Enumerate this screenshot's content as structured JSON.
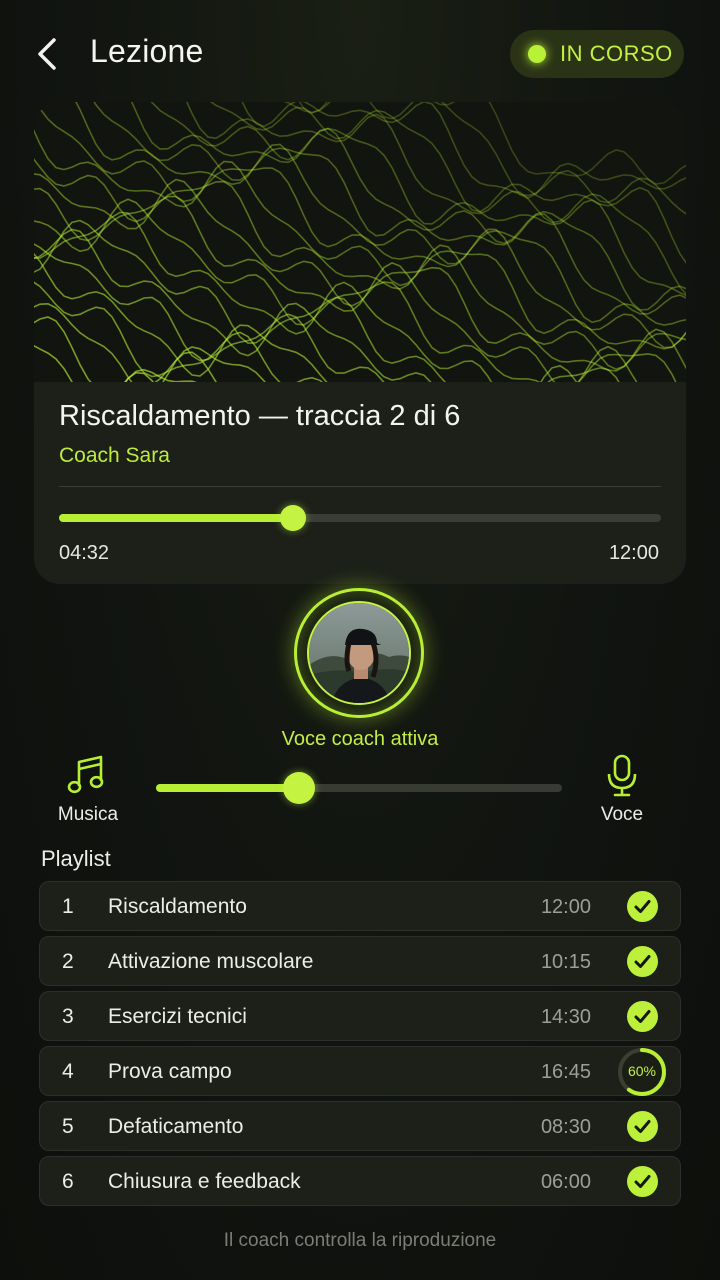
{
  "header": {
    "title": "Lezione",
    "status": "IN CORSO"
  },
  "player": {
    "track_title": "Riscaldamento — traccia 2 di 6",
    "coach_name": "Coach Sara",
    "elapsed": "04:32",
    "total": "12:00",
    "progress_fraction": 0.388
  },
  "coach": {
    "label": "Voce coach attiva"
  },
  "mix": {
    "left_label": "Musica",
    "right_label": "Voce",
    "level_fraction": 0.352
  },
  "playlist": {
    "heading": "Playlist",
    "items": [
      {
        "num": "1",
        "name": "Riscaldamento",
        "duration": "12:00",
        "state": "done"
      },
      {
        "num": "2",
        "name": "Attivazione muscolare",
        "duration": "10:15",
        "state": "done"
      },
      {
        "num": "3",
        "name": "Esercizi tecnici",
        "duration": "14:30",
        "state": "done"
      },
      {
        "num": "4",
        "name": "Prova campo",
        "duration": "16:45",
        "state": "progress",
        "progress_label": "60%",
        "progress_fraction": 0.6
      },
      {
        "num": "5",
        "name": "Defaticamento",
        "duration": "08:30",
        "state": "done"
      },
      {
        "num": "6",
        "name": "Chiusura e feedback",
        "duration": "06:00",
        "state": "done"
      }
    ]
  },
  "footer": {
    "note": "Il coach controlla la riproduzione"
  },
  "colors": {
    "accent": "#b8ef34",
    "background": "#111410",
    "card": "#1c2019",
    "muted_text": "#9c9e98"
  },
  "icons": {
    "back": "chevron-left-icon",
    "music": "music-note-icon",
    "voice": "microphone-icon",
    "done": "check-circle-icon"
  }
}
